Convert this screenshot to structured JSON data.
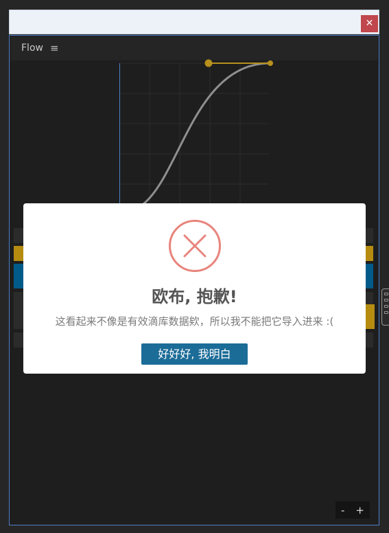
{
  "window": {
    "close_label": "✕"
  },
  "toolbar": {
    "title": "Flow",
    "menu_icon": "hamburger-menu-icon",
    "menu_glyph": "≡"
  },
  "dialog": {
    "icon": "error-x-icon",
    "title": "欧布, 抱歉!",
    "message": "这看起来不像是有效滴库数据欸，所以我不能把它导入进来 :(",
    "confirm_label": "好好好, 我明白"
  },
  "zoom": {
    "out_label": "-",
    "in_label": "+"
  },
  "colors": {
    "accent_frame": "#4d7fc7",
    "handle_gold": "#b8901c",
    "row_gold": "#b58c10",
    "row_blue": "#005b8a",
    "close_red": "#c0474d",
    "error_icon": "#e8847c",
    "button_blue": "#1c6c98"
  }
}
